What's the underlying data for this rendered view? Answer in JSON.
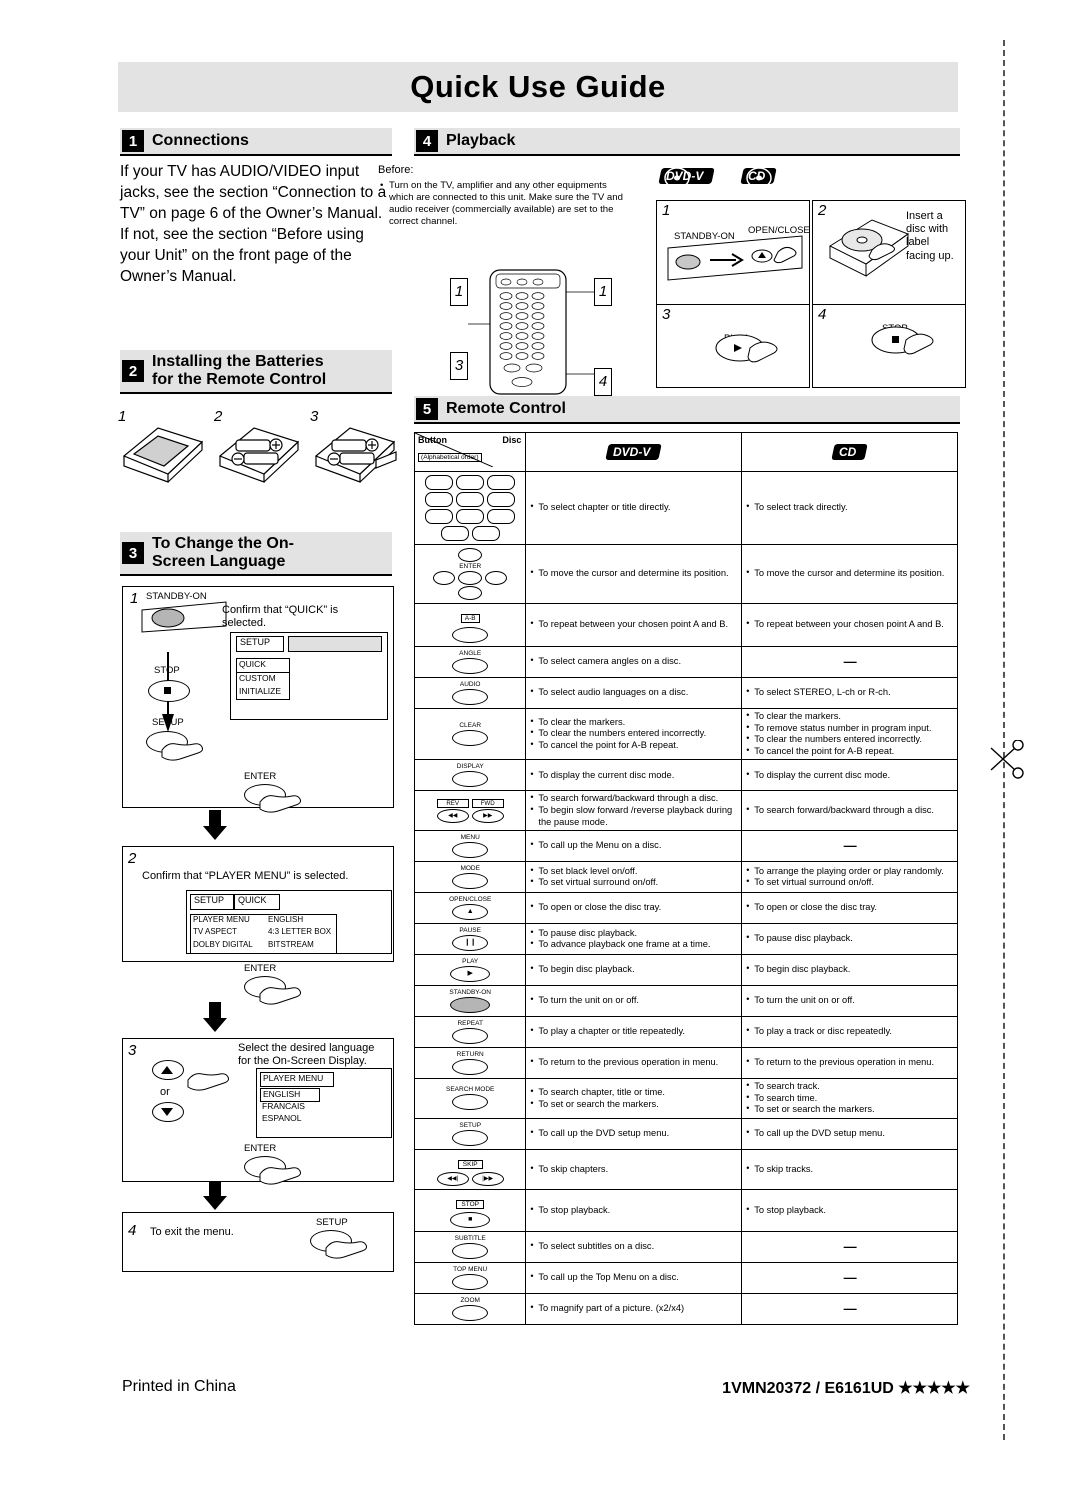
{
  "title": "Quick Use Guide",
  "sections": {
    "s1": {
      "num": "1",
      "label": "Connections"
    },
    "s2": {
      "num": "2",
      "label_line1": "Installing the Batteries",
      "label_line2": "for the Remote Control"
    },
    "s3": {
      "num": "3",
      "label_line1": "To Change the On-",
      "label_line2": "Screen Language"
    },
    "s4": {
      "num": "4",
      "label": "Playback"
    },
    "s5": {
      "num": "5",
      "label": "Remote Control"
    }
  },
  "connections": {
    "text": "If your TV has AUDIO/VIDEO input jacks, see the section “Connection to a TV” on page 6 of the Owner’s Manual. If not, see the section “Before using your Unit” on the front page of the Owner’s Manual."
  },
  "batteries": {
    "steps": [
      "1",
      "2",
      "3"
    ]
  },
  "language": {
    "step1": {
      "num": "1",
      "caption": "Confirm that “QUICK” is selected.",
      "device_label": "STANDBY-ON",
      "stop_label": "STOP",
      "setup_label": "SETUP",
      "menu_title": "SETUP",
      "menu_items": [
        "QUICK",
        "CUSTOM",
        "INITIALIZE"
      ],
      "enter_label": "ENTER"
    },
    "step2": {
      "num": "2",
      "caption": "Confirm that “PLAYER MENU” is selected.",
      "menu_title": "SETUP",
      "menu_tab": "QUICK",
      "rows": [
        [
          "PLAYER MENU",
          "ENGLISH"
        ],
        [
          "TV ASPECT",
          "4:3 LETTER BOX"
        ],
        [
          "DOLBY DIGITAL",
          "BITSTREAM"
        ]
      ],
      "enter_label": "ENTER"
    },
    "step3": {
      "num": "3",
      "caption": "Select the desired language for the On-Screen Display.",
      "or_label": "or",
      "menu_title": "PLAYER MENU",
      "menu_items": [
        "ENGLISH",
        "FRANCAIS",
        "ESPANOL"
      ],
      "enter_label": "ENTER"
    },
    "step4": {
      "num": "4",
      "caption": "To exit the menu.",
      "setup_label": "SETUP"
    }
  },
  "playback": {
    "before_label": "Before:",
    "before_text": "Turn on the TV, amplifier and any other equipments which are connected to this unit. Make sure the TV and audio receiver (commercially available) are set to the correct channel.",
    "disc_badges": [
      "DVD-V",
      "CD"
    ],
    "remote_nums": [
      "1",
      "1",
      "3",
      "4"
    ],
    "steps": [
      {
        "num": "1",
        "left_label": "STANDBY-ON",
        "right_label": "OPEN/CLOSE"
      },
      {
        "num": "2",
        "caption": "Insert a disc with label facing up."
      },
      {
        "num": "3",
        "caption": "",
        "button": "PLAY"
      },
      {
        "num": "4",
        "caption": "",
        "button": "STOP"
      }
    ]
  },
  "remote_table": {
    "header": {
      "button": "Button",
      "button_sub": "(Alphabetical order)",
      "disc": "Disc",
      "dvd": "DVD-V",
      "cd": "CD"
    },
    "rows": [
      {
        "key": "numbers",
        "label": "",
        "dvd": [
          "To select chapter or title directly."
        ],
        "cd": [
          "To select track directly."
        ]
      },
      {
        "key": "cursor",
        "label": "ENTER",
        "dvd": [
          "To move the cursor and determine its position."
        ],
        "cd": [
          "To move the cursor and determine its position."
        ]
      },
      {
        "key": "ab",
        "label": "A-B",
        "dvd": [
          "To repeat between your chosen point A and B."
        ],
        "cd": [
          "To repeat between your chosen point A and B."
        ]
      },
      {
        "key": "angle",
        "label": "ANGLE",
        "dvd": [
          "To select camera angles on a disc."
        ],
        "cd": [
          "—"
        ]
      },
      {
        "key": "audio",
        "label": "AUDIO",
        "dvd": [
          "To select audio languages on a disc."
        ],
        "cd": [
          "To select STEREO, L-ch or R-ch."
        ]
      },
      {
        "key": "clear",
        "label": "CLEAR",
        "dvd": [
          "To clear the markers.",
          "To clear the numbers entered incorrectly.",
          "To cancel the point for A-B repeat."
        ],
        "cd": [
          "To clear the markers.",
          "To remove status number in program input.",
          "To clear the numbers entered incorrectly.",
          "To cancel the point for A-B repeat."
        ]
      },
      {
        "key": "display",
        "label": "DISPLAY",
        "dvd": [
          "To display the current disc mode."
        ],
        "cd": [
          "To display the current disc mode."
        ]
      },
      {
        "key": "revfwd",
        "label": "REV / FWD",
        "dvd": [
          "To search forward/backward through a disc.",
          "To begin slow forward /reverse playback during the pause mode."
        ],
        "cd": [
          "To search forward/backward through a disc."
        ]
      },
      {
        "key": "menu",
        "label": "MENU",
        "dvd": [
          "To call up the Menu on a disc."
        ],
        "cd": [
          "—"
        ]
      },
      {
        "key": "mode",
        "label": "MODE",
        "dvd": [
          "To set black level on/off.",
          "To set virtual surround on/off."
        ],
        "cd": [
          "To arrange the playing order or play randomly.",
          "To set virtual surround on/off."
        ]
      },
      {
        "key": "openclose",
        "label": "OPEN/CLOSE",
        "dvd": [
          "To open or close the disc tray."
        ],
        "cd": [
          "To open or close the disc tray."
        ]
      },
      {
        "key": "pause",
        "label": "PAUSE",
        "dvd": [
          "To pause disc playback.",
          "To advance playback one frame at a time."
        ],
        "cd": [
          "To pause disc playback."
        ]
      },
      {
        "key": "play",
        "label": "PLAY",
        "dvd": [
          "To begin disc playback."
        ],
        "cd": [
          "To begin disc playback."
        ]
      },
      {
        "key": "standby",
        "label": "STANDBY-ON",
        "dvd": [
          "To turn the unit on or off."
        ],
        "cd": [
          "To turn the unit on or off."
        ]
      },
      {
        "key": "repeat",
        "label": "REPEAT",
        "dvd": [
          "To play a chapter or title repeatedly."
        ],
        "cd": [
          "To play a track or disc repeatedly."
        ]
      },
      {
        "key": "return",
        "label": "RETURN",
        "dvd": [
          "To return to the previous operation in menu."
        ],
        "cd": [
          "To return to the previous operation in menu."
        ]
      },
      {
        "key": "searchmode",
        "label": "SEARCH MODE",
        "dvd": [
          "To search chapter, title or time.",
          "To set or search the markers."
        ],
        "cd": [
          "To search track.",
          "To search time.",
          "To set or search the markers."
        ]
      },
      {
        "key": "setup",
        "label": "SETUP",
        "dvd": [
          "To call up the DVD setup menu."
        ],
        "cd": [
          "To call up the DVD setup menu."
        ]
      },
      {
        "key": "skip",
        "label": "SKIP",
        "dvd": [
          "To skip chapters."
        ],
        "cd": [
          "To skip tracks."
        ]
      },
      {
        "key": "stop",
        "label": "STOP",
        "dvd": [
          "To stop playback."
        ],
        "cd": [
          "To stop playback."
        ]
      },
      {
        "key": "subtitle",
        "label": "SUBTITLE",
        "dvd": [
          "To select subtitles on a disc."
        ],
        "cd": [
          "—"
        ]
      },
      {
        "key": "topmenu",
        "label": "TOP MENU",
        "dvd": [
          "To call up the Top Menu on a disc."
        ],
        "cd": [
          "—"
        ]
      },
      {
        "key": "zoom",
        "label": "ZOOM",
        "dvd": [
          "To magnify part of a picture. (x2/x4)"
        ],
        "cd": [
          "—"
        ]
      }
    ]
  },
  "footer": {
    "left": "Printed in China",
    "right": "1VMN20372 / E6161UD ★★★★★"
  }
}
